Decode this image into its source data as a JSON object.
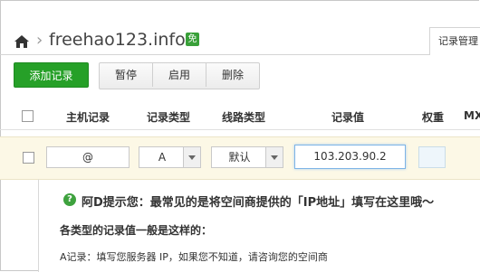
{
  "breadcrumb": {
    "separator": "›",
    "domain": "freehao123.info",
    "badge": "免"
  },
  "tabs": {
    "active": "记录管理"
  },
  "toolbar": {
    "add": "添加记录",
    "pause": "暂停",
    "enable": "启用",
    "delete": "删除"
  },
  "columns": {
    "host": "主机记录",
    "type": "记录类型",
    "line": "线路类型",
    "value": "记录值",
    "weight": "权重",
    "mx": "MX"
  },
  "row": {
    "host": "@",
    "type": "A",
    "line": "默认",
    "value": "103.203.90.2",
    "weight": ""
  },
  "tip": {
    "icon": "?",
    "title": "阿D提示您：最常见的是将空间商提供的「IP地址」填写在这里哦～",
    "subtitle": "各类型的记录值一般是这样的：",
    "a_record": "A记录：填写您服务器 IP，如果您不知道，请咨询您的空间商"
  },
  "colors": {
    "accent_green": "#26a028",
    "focus_blue": "#7db4e6",
    "row_highlight": "#fcf8e6"
  }
}
